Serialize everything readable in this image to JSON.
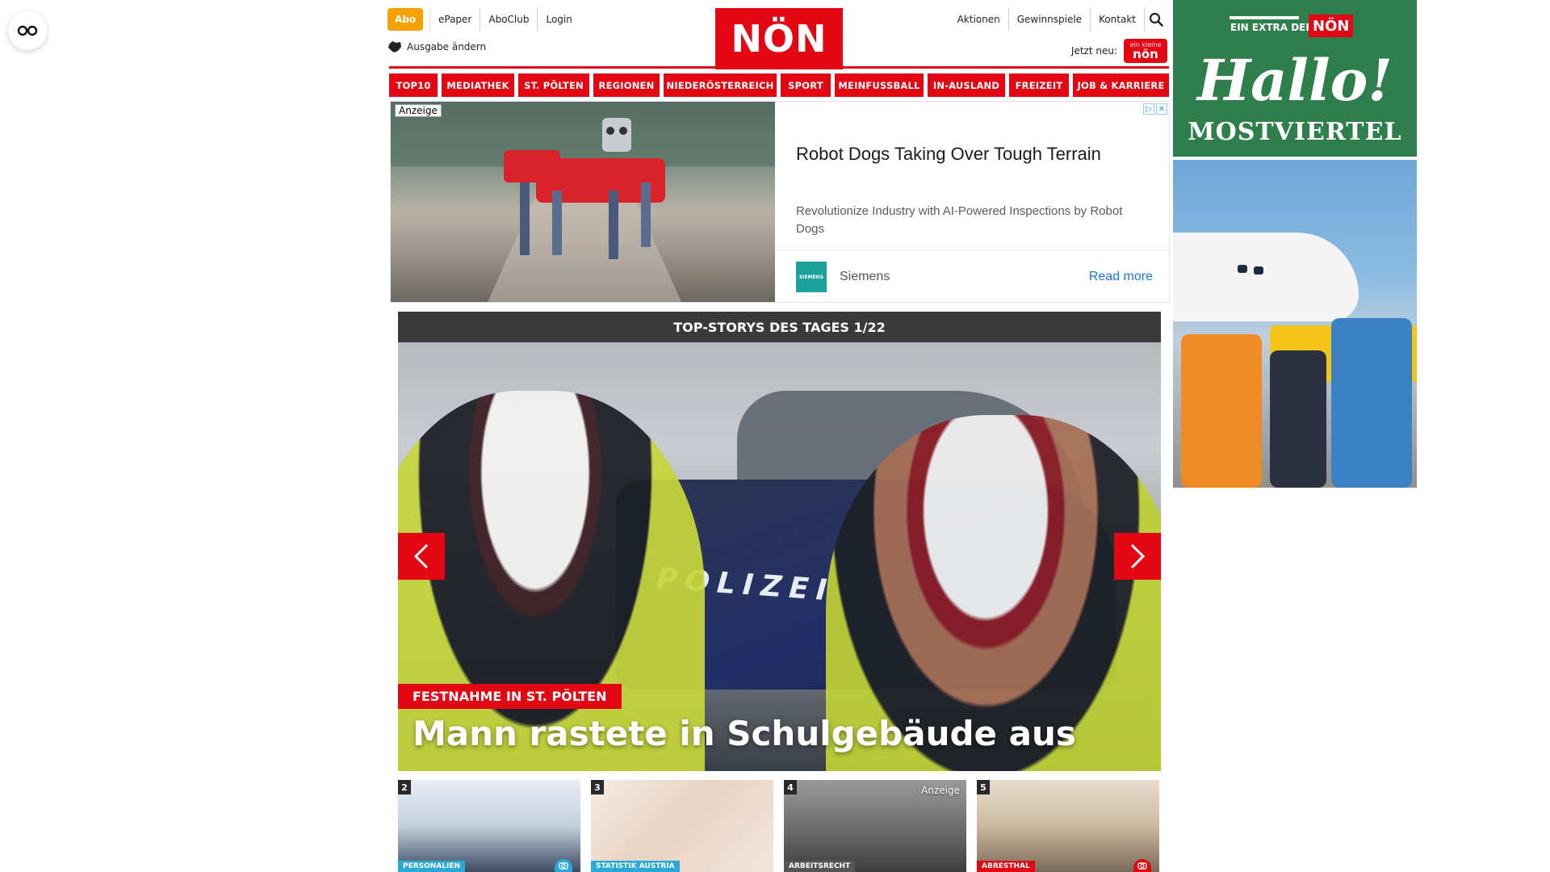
{
  "header": {
    "abo": "Abo",
    "top_links": [
      "ePaper",
      "AboClub",
      "Login"
    ],
    "ausgabe": "Ausgabe ändern",
    "logo": "NÖN",
    "right_links": [
      "Aktionen",
      "Gewinnspiele",
      "Kontakt"
    ],
    "jetzt_neu": "Jetzt neu:",
    "jetzt_badge": "nön",
    "jetzt_badge_small": "ein kleine"
  },
  "nav": {
    "items": [
      "TOP10",
      "MEDIATHEK",
      "ST. PÖLTEN",
      "REGIONEN",
      "NIEDERÖSTERREICH",
      "SPORT",
      "MEINFUSSBALL",
      "IN-AUSLAND",
      "FREIZEIT",
      "JOB & KARRIERE"
    ]
  },
  "ad": {
    "label": "Anzeige",
    "title": "Robot Dogs Taking Over Tough Terrain",
    "description": "Revolutionize Industry with AI-Powered Inspections by Robot Dogs",
    "brand": "Siemens",
    "brand_logo": "SIEMENS",
    "cta": "Read more"
  },
  "stories": {
    "heading": "TOP-STORYS DES TAGES 1/22",
    "hero": {
      "kicker": "FESTNAHME IN ST. PÖLTEN",
      "title": "Mann rastete in Schulgebäude aus",
      "vehicle_text": "POLIZEI"
    },
    "thumbs": [
      {
        "num": "2",
        "tag": "PERSONALIEN",
        "tag_color": "#2aa8d8"
      },
      {
        "num": "3",
        "tag": "STATISTIK AUSTRIA",
        "tag_color": "#2aa8d8"
      },
      {
        "num": "4",
        "tag": "ARBEITSRECHT",
        "tag_color": "#555555",
        "anzeige": "Anzeige"
      },
      {
        "num": "5",
        "tag": "ABRESTHAL",
        "tag_color": "#e30613"
      }
    ]
  },
  "rail_ad": {
    "extra": "EIN EXTRA DER",
    "non": "NÖN",
    "hallo": "Hallo!",
    "region": "MOSTVIERTEL"
  },
  "colors": {
    "brand_red": "#e30613",
    "abo_orange": "#f5a200",
    "rail_green": "#2f7f4c"
  }
}
